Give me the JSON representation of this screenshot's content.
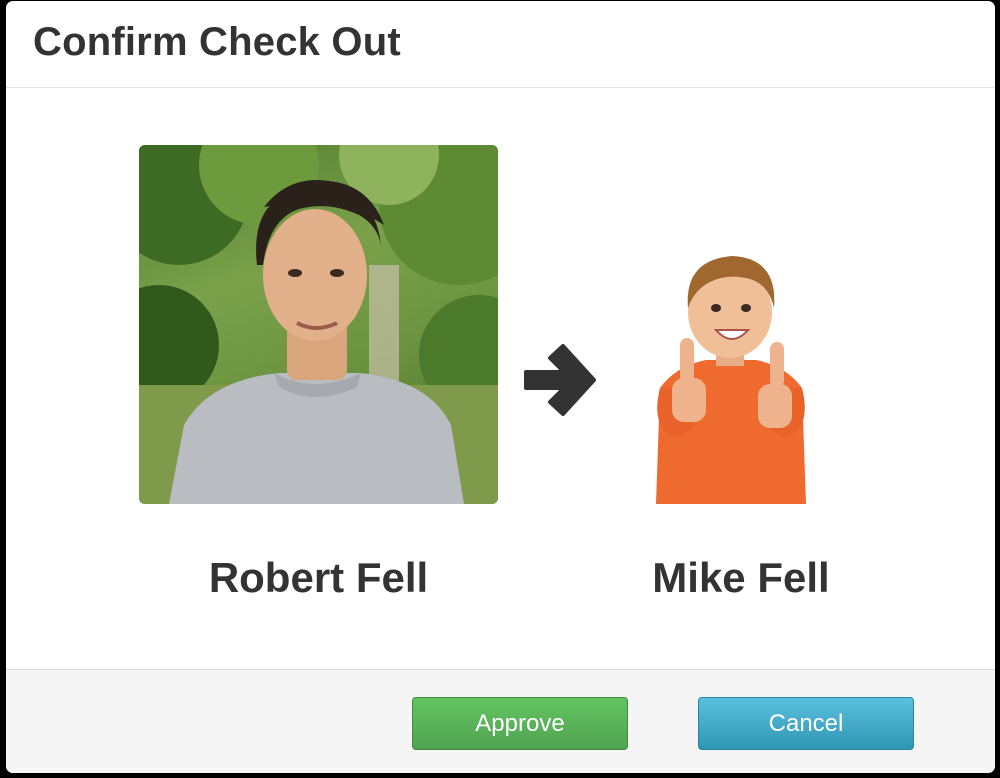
{
  "dialog": {
    "title": "Confirm Check Out"
  },
  "from_person": {
    "name": "Robert Fell",
    "photo": "adult-man-photo"
  },
  "to_person": {
    "name": "Mike Fell",
    "photo": "child-thumbs-up-photo"
  },
  "transfer_icon": "right-arrow-icon",
  "footer": {
    "approve_label": "Approve",
    "cancel_label": "Cancel"
  },
  "colors": {
    "approve": "#5bb75b",
    "cancel": "#49afcd",
    "text": "#333333"
  }
}
